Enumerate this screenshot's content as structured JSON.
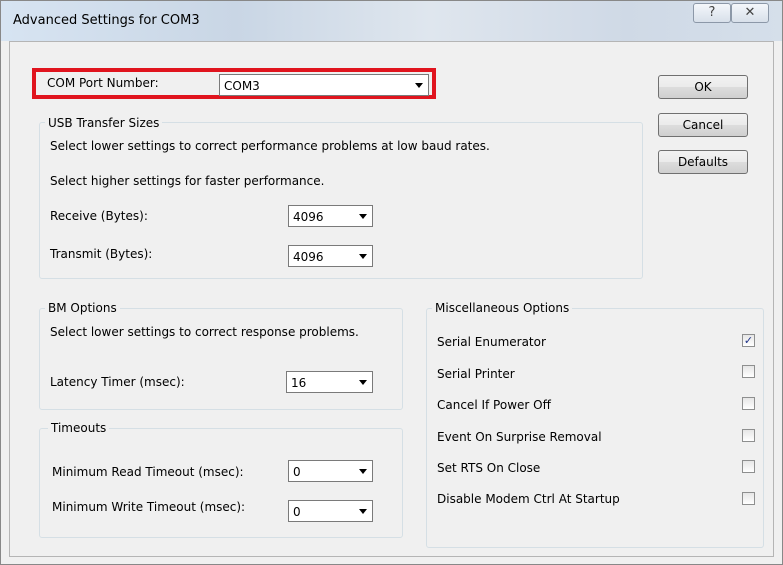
{
  "window": {
    "title": "Advanced Settings for COM3",
    "help_glyph": "?",
    "close_glyph": "✕"
  },
  "com_port": {
    "label": "COM Port Number:",
    "value": "COM3",
    "highlight_color": "#e0141e"
  },
  "buttons": {
    "ok": "OK",
    "cancel": "Cancel",
    "defaults": "Defaults"
  },
  "usb": {
    "title": "USB Transfer Sizes",
    "desc1": "Select lower settings to correct performance problems at low baud rates.",
    "desc2": "Select higher settings for faster performance.",
    "receive_label": "Receive (Bytes):",
    "receive_value": "4096",
    "transmit_label": "Transmit (Bytes):",
    "transmit_value": "4096"
  },
  "bm": {
    "title": "BM Options",
    "desc": "Select lower settings to correct response problems.",
    "latency_label": "Latency Timer (msec):",
    "latency_value": "16"
  },
  "timeouts": {
    "title": "Timeouts",
    "read_label": "Minimum Read Timeout (msec):",
    "read_value": "0",
    "write_label": "Minimum Write Timeout (msec):",
    "write_value": "0"
  },
  "misc": {
    "title": "Miscellaneous Options",
    "options": [
      {
        "label": "Serial Enumerator",
        "checked": true
      },
      {
        "label": "Serial Printer",
        "checked": false
      },
      {
        "label": "Cancel If Power Off",
        "checked": false
      },
      {
        "label": "Event On Surprise Removal",
        "checked": false
      },
      {
        "label": "Set RTS On Close",
        "checked": false
      },
      {
        "label": "Disable Modem Ctrl At Startup",
        "checked": false
      }
    ]
  }
}
